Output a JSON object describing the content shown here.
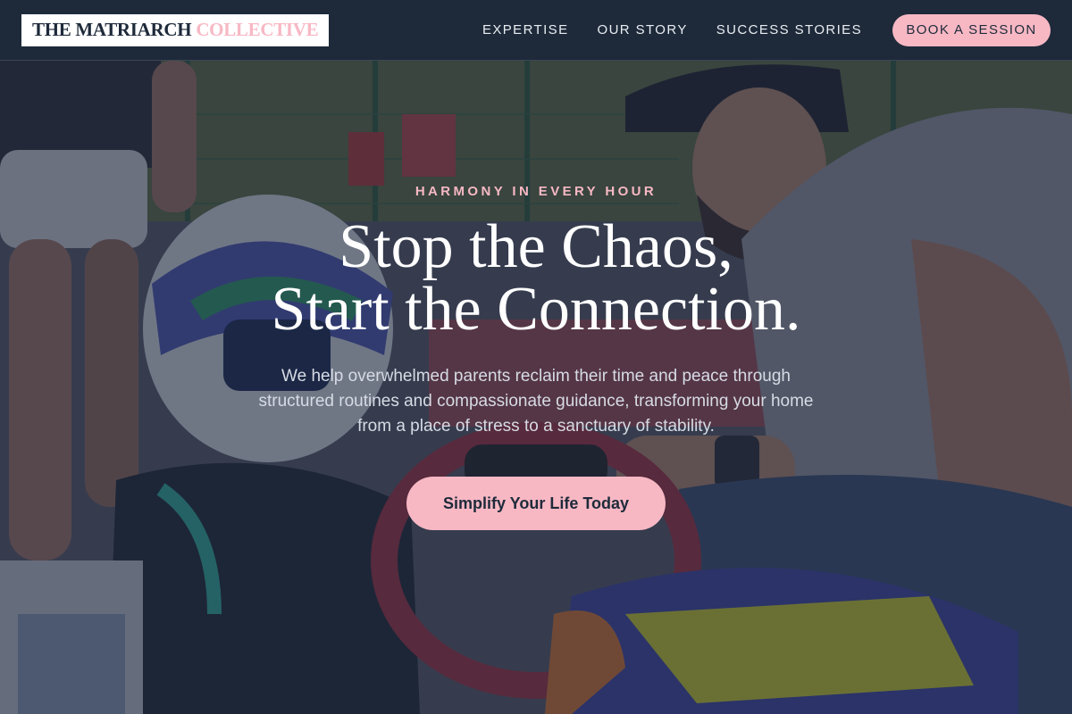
{
  "brand": {
    "name_primary": "THE MATRIARCH",
    "name_accent": "COLLECTIVE"
  },
  "nav": {
    "links": [
      {
        "label": "EXPERTISE"
      },
      {
        "label": "OUR STORY"
      },
      {
        "label": "SUCCESS STORIES"
      }
    ],
    "cta_label": "BOOK A SESSION"
  },
  "hero": {
    "eyebrow": "HARMONY IN EVERY HOUR",
    "headline_line1": "Stop the Chaos,",
    "headline_line2": "Start the Connection.",
    "subtext": "We help overwhelmed parents reclaim their time and peace through structured routines and compassionate guidance, transforming your home from a place of stress to a sanctuary of stability.",
    "cta_label": "Simplify Your Life Today",
    "background_image": "karting-photo"
  },
  "colors": {
    "navy": "#1e2a3a",
    "accent_pink": "#f7b8c4",
    "white": "#ffffff",
    "overlay": "#1e263c"
  }
}
